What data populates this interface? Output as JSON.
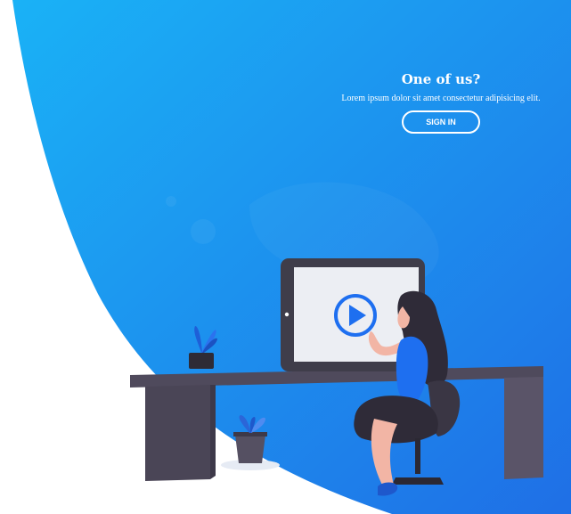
{
  "panel": {
    "title": "One of us?",
    "text": "Lorem ipsum dolor sit amet consectetur adipisicing elit.",
    "button_label": "SIGN IN"
  },
  "colors": {
    "gradient_start": "#1aa9f5",
    "gradient_end": "#1e7ae6",
    "desk": "#4f4a5c",
    "desk_leg": "#585266",
    "tablet_frame": "#3f3d4a",
    "tablet_screen": "#e9ecf1",
    "play_accent": "#1e6ff0",
    "woman_top": "#1e6ff0",
    "woman_hair": "#2f2b38",
    "skin": "#f2b5a5"
  },
  "illustration": {
    "description_icon": "person-watching-video-icon"
  }
}
